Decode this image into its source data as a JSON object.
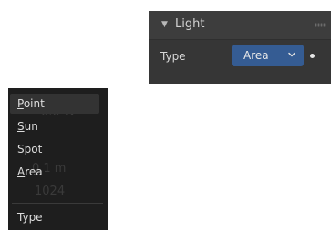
{
  "panel": {
    "title": "Light",
    "expanded": true,
    "property_label": "Type",
    "type_value": "Area",
    "accent": "#355c93"
  },
  "menu": {
    "items": [
      {
        "label": "Point",
        "mnemonic": "P",
        "rest": "oint",
        "active": true
      },
      {
        "label": "Sun",
        "mnemonic": "S",
        "rest": "un",
        "active": false
      },
      {
        "label": "Spot",
        "mnemonic": "",
        "rest": "Spot",
        "active": false
      },
      {
        "label": "Area",
        "mnemonic": "A",
        "rest": "rea",
        "active": false
      }
    ],
    "footer_label": "Type",
    "background_values": [
      "0.0 W",
      "0.1 m",
      "1024"
    ]
  }
}
